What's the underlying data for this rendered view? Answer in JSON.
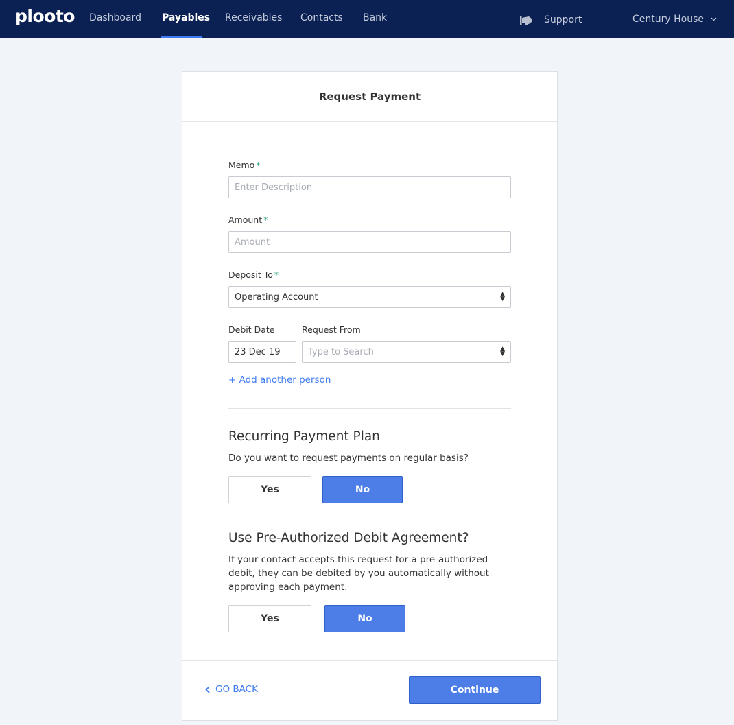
{
  "nav": {
    "logo": "plooto",
    "items": [
      {
        "label": "Dashboard",
        "active": false
      },
      {
        "label": "Payables",
        "active": true
      },
      {
        "label": "Receivables",
        "active": false
      },
      {
        "label": "Contacts",
        "active": false
      },
      {
        "label": "Bank",
        "active": false
      }
    ],
    "support_label": "Support",
    "support_icon": "megaphone-icon",
    "account_label": "Century House",
    "account_icon": "chevron-down-icon"
  },
  "form": {
    "title": "Request Payment",
    "memo": {
      "label": "Memo",
      "required_mark": "*",
      "value": "",
      "placeholder": "Enter Description"
    },
    "amount": {
      "label": "Amount",
      "required_mark": "*",
      "value": "",
      "placeholder": "Amount"
    },
    "deposit_to": {
      "label": "Deposit To",
      "required_mark": "*",
      "value": "Operating Account"
    },
    "debit_date": {
      "label": "Debit Date",
      "value": "23 Dec 19"
    },
    "request_from": {
      "label": "Request From",
      "placeholder": "Type to Search"
    },
    "add_person": "+ Add another person"
  },
  "recurring": {
    "title": "Recurring Payment Plan",
    "text": "Do you want to request payments on regular basis?",
    "yes_label": "Yes",
    "no_label": "No",
    "selected": "No"
  },
  "pad": {
    "title": "Use Pre-Authorized Debit Agreement?",
    "text": "If your contact accepts this request for a pre-authorized debit, they can be debited by you automatically without approving each payment.",
    "yes_label": "Yes",
    "no_label": "No",
    "selected": "No"
  },
  "footer": {
    "back_label": "GO BACK",
    "continue_label": "Continue"
  },
  "colors": {
    "navbar": "#0b2154",
    "accent": "#3e7bf2",
    "primary_button": "#4d7ee8",
    "required": "#2ba57a"
  }
}
